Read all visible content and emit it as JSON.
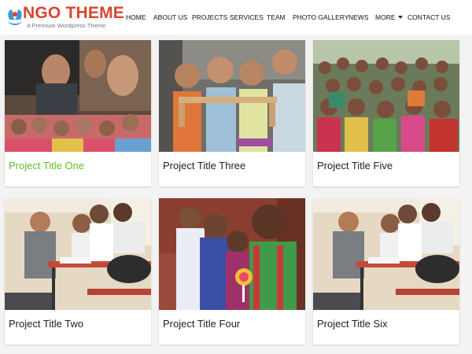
{
  "site": {
    "logo_title": "NGO THEME",
    "logo_tagline": "A Premium Wordpress Theme",
    "accent_color": "#d9462f",
    "link_active_color": "#5fbf2a"
  },
  "nav": {
    "items": [
      "HOME",
      "ABOUT US",
      "PROJECTS",
      "SERVICES",
      "TEAM",
      "PHOTO GALLERY",
      "NEWS",
      "MORE",
      "CONTACT US"
    ]
  },
  "projects": [
    {
      "title": "Project Title One",
      "image": "film-poster-children-photo"
    },
    {
      "title": "Project Title Three",
      "image": "children-holding-wooden-frame-photo"
    },
    {
      "title": "Project Title Five",
      "image": "crowd-of-children-photo"
    },
    {
      "title": "Project Title Two",
      "image": "classroom-students-photo"
    },
    {
      "title": "Project Title Four",
      "image": "children-with-lollipop-photo"
    },
    {
      "title": "Project Title Six",
      "image": "classroom-students-photo"
    }
  ]
}
